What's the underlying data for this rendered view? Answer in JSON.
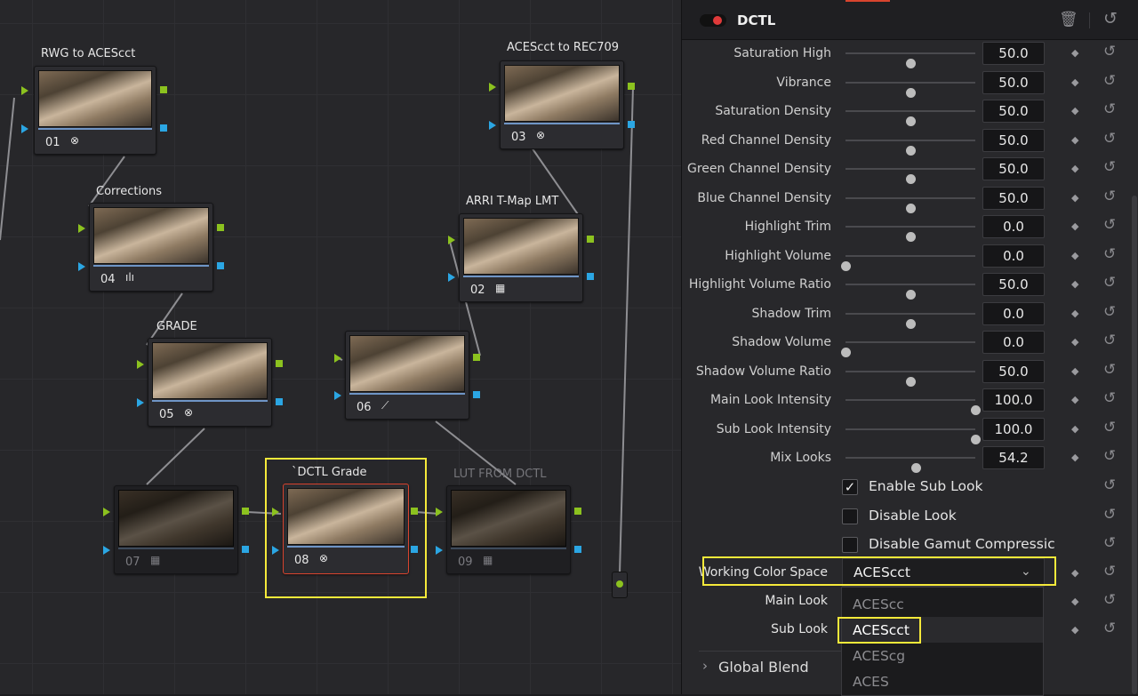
{
  "node_graph": {
    "nodes": [
      {
        "num": "01",
        "label": "RWG to ACEScct",
        "icon": "⊗"
      },
      {
        "num": "04",
        "label": "Corrections",
        "icon": "ılı"
      },
      {
        "num": "05",
        "label": "GRADE",
        "icon": "⊗"
      },
      {
        "num": "06",
        "label": "",
        "icon": "⟋"
      },
      {
        "num": "07",
        "label": "",
        "icon": "▦"
      },
      {
        "num": "08",
        "label": "`DCTL Grade",
        "icon": "⊗"
      },
      {
        "num": "09",
        "label": "LUT FROM DCTL",
        "icon": "▦"
      },
      {
        "num": "02",
        "label": "ARRI T-Map LMT",
        "icon": "▦"
      },
      {
        "num": "03",
        "label": "ACEScct to REC709",
        "icon": "⊗"
      }
    ],
    "colors": {
      "input_green": "#8cc21f",
      "output_blue": "#2ba6e3",
      "selected_border": "#d8442e",
      "highlight": "#f5e93a"
    }
  },
  "panel": {
    "title": "DCTL",
    "enabled": true,
    "trash_icon": "🗑",
    "reset_icon": "↺",
    "keyframe_icon": "◆",
    "params": [
      {
        "label": "Saturation High",
        "value": "50.0",
        "fraction": 0.5
      },
      {
        "label": "Vibrance",
        "value": "50.0",
        "fraction": 0.5
      },
      {
        "label": "Saturation Density",
        "value": "50.0",
        "fraction": 0.5
      },
      {
        "label": "Red Channel Density",
        "value": "50.0",
        "fraction": 0.5
      },
      {
        "label": "Green Channel Density",
        "value": "50.0",
        "fraction": 0.5
      },
      {
        "label": "Blue Channel Density",
        "value": "50.0",
        "fraction": 0.5
      },
      {
        "label": "Highlight Trim",
        "value": "0.0",
        "fraction": 0.5
      },
      {
        "label": "Highlight Volume",
        "value": "0.0",
        "fraction": 0.0
      },
      {
        "label": "Highlight Volume Ratio",
        "value": "50.0",
        "fraction": 0.5
      },
      {
        "label": "Shadow Trim",
        "value": "0.0",
        "fraction": 0.5
      },
      {
        "label": "Shadow Volume",
        "value": "0.0",
        "fraction": 0.0
      },
      {
        "label": "Shadow Volume Ratio",
        "value": "50.0",
        "fraction": 0.5
      },
      {
        "label": "Main Look Intensity",
        "value": "100.0",
        "fraction": 1.0
      },
      {
        "label": "Sub Look Intensity",
        "value": "100.0",
        "fraction": 1.0
      },
      {
        "label": "Mix Looks",
        "value": "54.2",
        "fraction": 0.54
      }
    ],
    "checkboxes": [
      {
        "label": "Enable Sub Look",
        "checked": true,
        "mark": "✓"
      },
      {
        "label": "Disable Look",
        "checked": false,
        "mark": ""
      },
      {
        "label": "Disable Gamut Compressic",
        "checked": false,
        "mark": ""
      }
    ],
    "working_color_space": {
      "label": "Working Color Space",
      "value": "ACEScct",
      "chevron": "⌄"
    },
    "main_look": {
      "label": "Main Look"
    },
    "sub_look": {
      "label": "Sub Look"
    },
    "dropdown_options": [
      {
        "label": "ACEScc",
        "selected": false
      },
      {
        "label": "ACEScct",
        "selected": true
      },
      {
        "label": "ACEScg",
        "selected": false
      },
      {
        "label": "ACES",
        "selected": false
      }
    ],
    "global_blend": {
      "label": "Global Blend",
      "chevron": "›"
    }
  }
}
